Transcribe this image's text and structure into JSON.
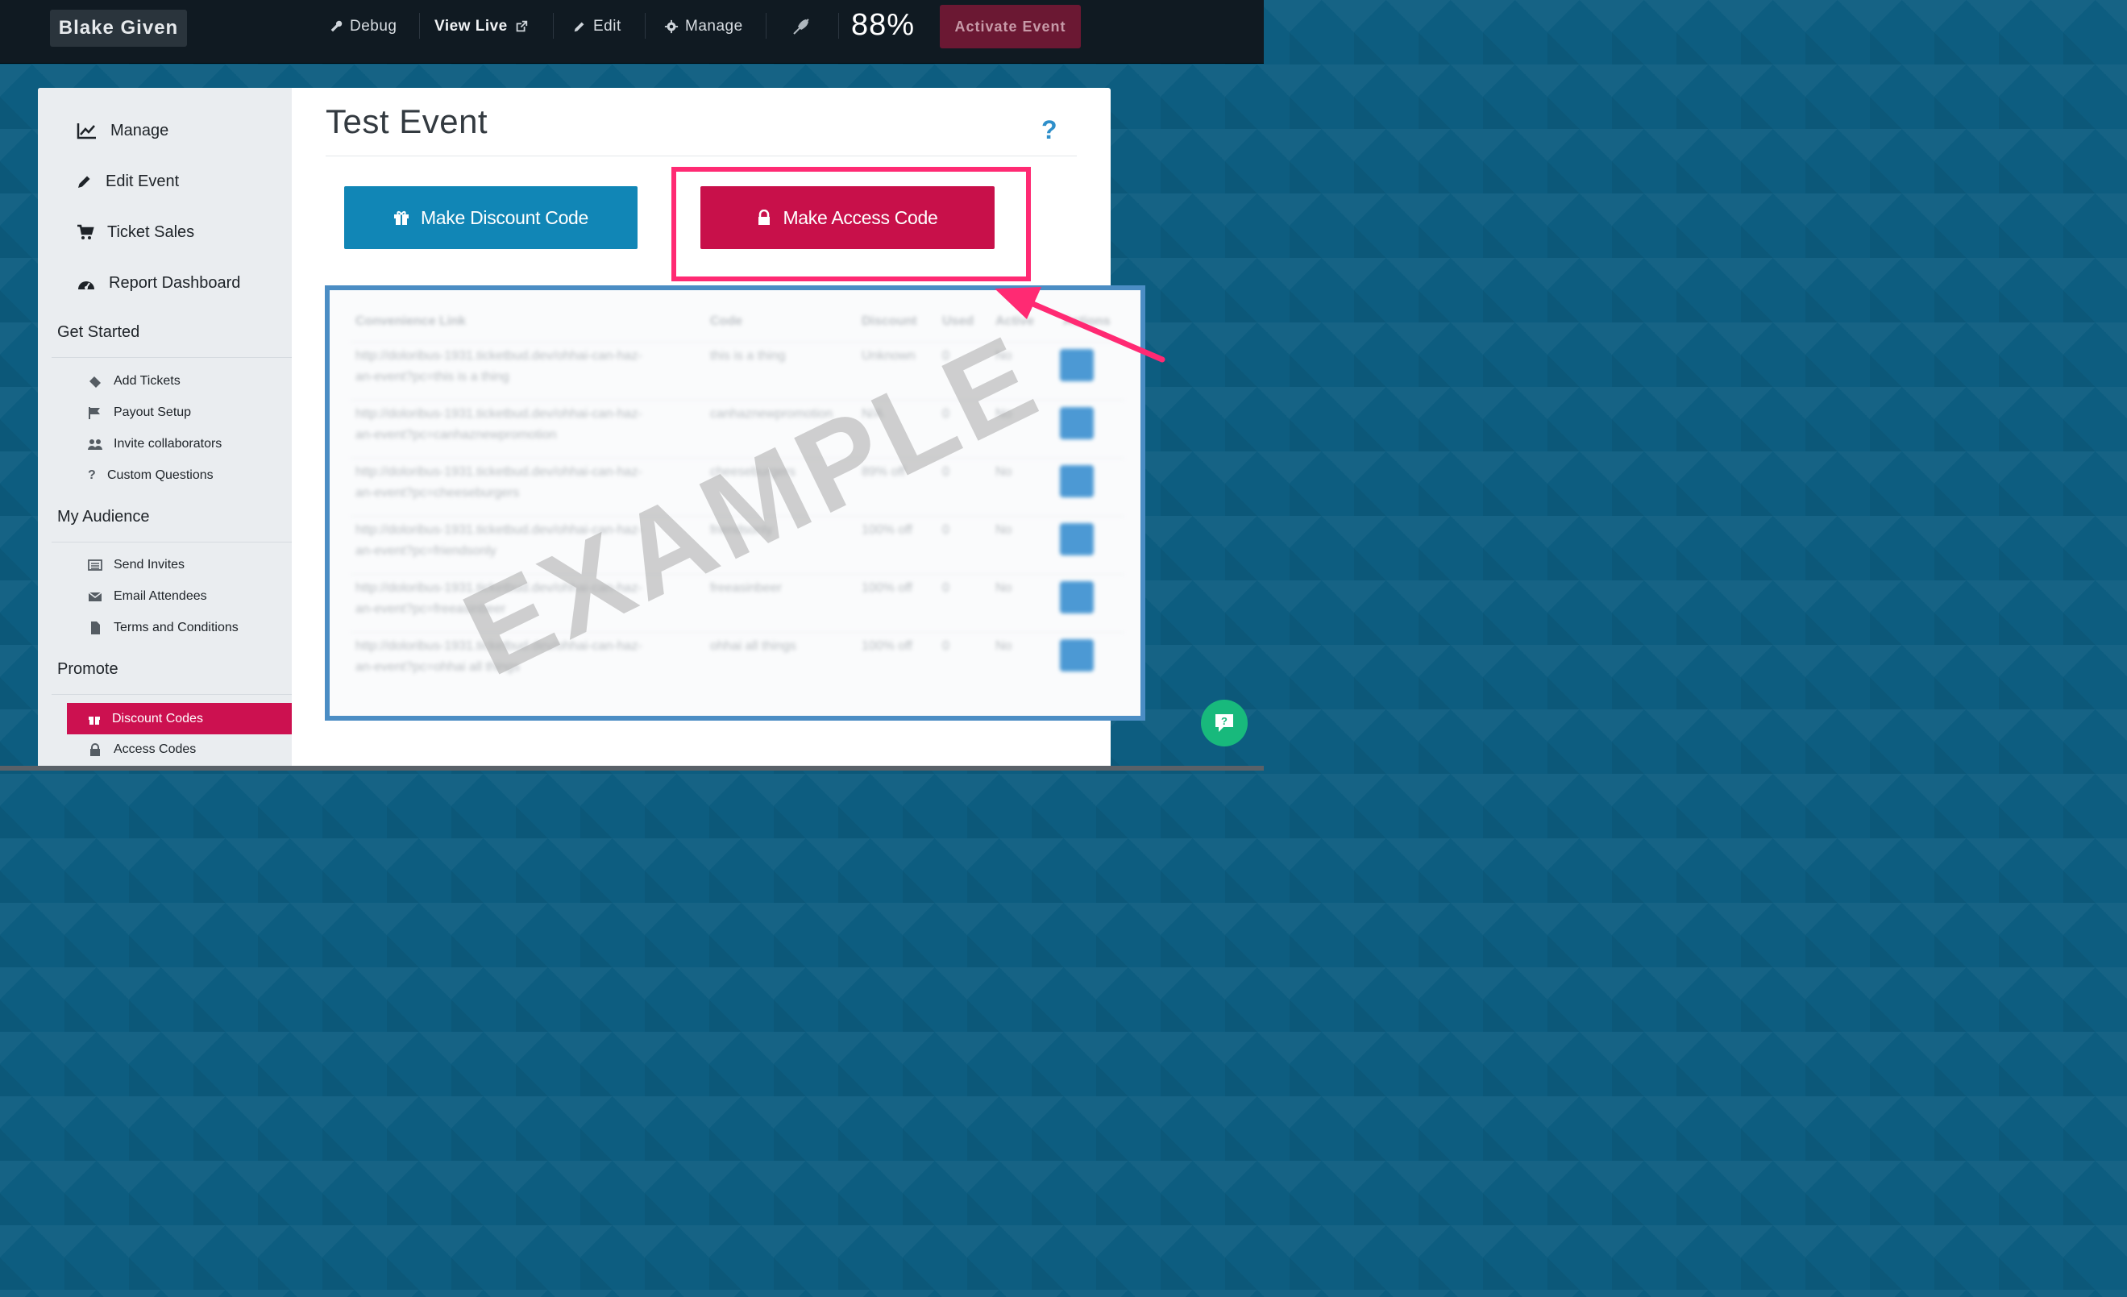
{
  "topbar": {
    "brand": "Blake Given",
    "nav": [
      "Debug",
      "View Live",
      "Edit",
      "Manage"
    ],
    "percent": "88%",
    "activate_label": "Activate Event"
  },
  "sidebar": {
    "main": [
      "Manage",
      "Edit Event",
      "Ticket Sales",
      "Report Dashboard"
    ],
    "sections": [
      {
        "title": "Get Started",
        "items": [
          "Add Tickets",
          "Payout Setup",
          "Invite collaborators",
          "Custom Questions"
        ]
      },
      {
        "title": "My Audience",
        "items": [
          "Send Invites",
          "Email Attendees",
          "Terms and Conditions"
        ]
      },
      {
        "title": "Promote",
        "items": [
          "Discount Codes",
          "Access Codes"
        ]
      }
    ]
  },
  "main": {
    "title": "Test Event",
    "help": "?",
    "discount_button": "Make Discount Code",
    "access_button": "Make Access Code",
    "watermark": "EXAMPLE"
  },
  "table": {
    "headers": [
      "Convenience Link",
      "Code",
      "Discount",
      "Used",
      "Active",
      "Actions"
    ],
    "rows": [
      {
        "link1": "http://doloribus-1931.ticketbud.dev/ohhai-can-haz-",
        "link2": "an-event?pc=this is a thing",
        "code": "this is a thing",
        "discount": "Unknown",
        "used": "0",
        "active": "No"
      },
      {
        "link1": "http://doloribus-1931.ticketbud.dev/ohhai-can-haz-",
        "link2": "an-event?pc=canhaznewpromotion",
        "code": "canhaznewpromotion",
        "discount": "N/A",
        "used": "0",
        "active": "No"
      },
      {
        "link1": "http://doloribus-1931.ticketbud.dev/ohhai-can-haz-",
        "link2": "an-event?pc=cheeseburgers",
        "code": "cheeseburgers",
        "discount": "89% off",
        "used": "0",
        "active": "No"
      },
      {
        "link1": "http://doloribus-1931.ticketbud.dev/ohhai-can-haz-",
        "link2": "an-event?pc=friendsonly",
        "code": "friendsonly",
        "discount": "100% off",
        "used": "0",
        "active": "No"
      },
      {
        "link1": "http://doloribus-1931.ticketbud.dev/ohhai-can-haz-",
        "link2": "an-event?pc=freeasinbeer",
        "code": "freeasinbeer",
        "discount": "100% off",
        "used": "0",
        "active": "No"
      },
      {
        "link1": "http://doloribus-1931.ticketbud.dev/ohhai-can-haz-",
        "link2": "an-event?pc=ohhai all things",
        "code": "ohhai all things",
        "discount": "100% off",
        "used": "0",
        "active": "No"
      }
    ]
  },
  "colors": {
    "accent": "#c8104a",
    "primary": "#1186b6",
    "highlight": "#ff2a73",
    "chat": "#18b97c"
  }
}
